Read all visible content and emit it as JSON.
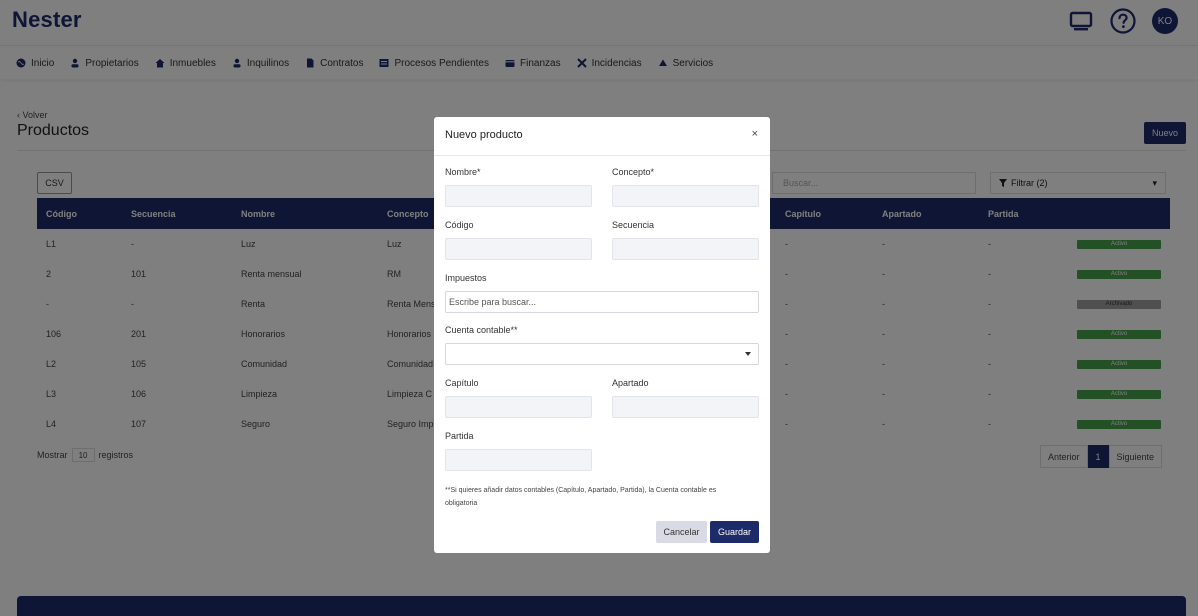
{
  "app": {
    "brand": "Nester",
    "avatar_initials": "KO"
  },
  "colors": {
    "primary": "#1e2b6b",
    "active_badge": "#46a049",
    "archived_badge": "#9e9e9e"
  },
  "nav": [
    {
      "label": "Inicio",
      "icon": "globe-icon"
    },
    {
      "label": "Propietarios",
      "icon": "user-icon"
    },
    {
      "label": "Inmuebles",
      "icon": "home-icon"
    },
    {
      "label": "Inquilinos",
      "icon": "user-icon"
    },
    {
      "label": "Contratos",
      "icon": "document-icon"
    },
    {
      "label": "Procesos Pendientes",
      "icon": "list-icon"
    },
    {
      "label": "Finanzas",
      "icon": "wallet-icon"
    },
    {
      "label": "Incidencias",
      "icon": "tools-icon"
    },
    {
      "label": "Servicios",
      "icon": "triangle-icon"
    }
  ],
  "page": {
    "back_label": "Volver",
    "title": "Productos",
    "new_label": "Nuevo"
  },
  "toolbar": {
    "csv_label": "CSV",
    "search_placeholder": "Buscar...",
    "filter_label": "Filtrar (2)"
  },
  "table": {
    "columns": [
      "Código",
      "Secuencia",
      "Nombre",
      "Concepto",
      "Capítulo",
      "Apartado",
      "Partida"
    ],
    "rows": [
      {
        "codigo": "L1",
        "secuencia": "-",
        "nombre": "Luz",
        "concepto": "Luz",
        "capitulo": "-",
        "apartado": "-",
        "partida": "-",
        "estado": "Activo"
      },
      {
        "codigo": "2",
        "secuencia": "101",
        "nombre": "Renta mensual",
        "concepto": "RM",
        "capitulo": "-",
        "apartado": "-",
        "partida": "-",
        "estado": "Activo"
      },
      {
        "codigo": "-",
        "secuencia": "-",
        "nombre": "Renta",
        "concepto": "Renta Mens",
        "capitulo": "-",
        "apartado": "-",
        "partida": "-",
        "estado": "Archivado"
      },
      {
        "codigo": "106",
        "secuencia": "201",
        "nombre": "Honorarios",
        "concepto": "Honorarios",
        "capitulo": "-",
        "apartado": "-",
        "partida": "-",
        "estado": "Activo"
      },
      {
        "codigo": "L2",
        "secuencia": "105",
        "nombre": "Comunidad",
        "concepto": "Comunidad",
        "capitulo": "-",
        "apartado": "-",
        "partida": "-",
        "estado": "Activo"
      },
      {
        "codigo": "L3",
        "secuencia": "106",
        "nombre": "Limpieza",
        "concepto": "Limpieza C",
        "capitulo": "-",
        "apartado": "-",
        "partida": "-",
        "estado": "Activo"
      },
      {
        "codigo": "L4",
        "secuencia": "107",
        "nombre": "Seguro",
        "concepto": "Seguro Imp",
        "capitulo": "-",
        "apartado": "-",
        "partida": "-",
        "estado": "Activo"
      }
    ]
  },
  "pagination": {
    "show_label": "Mostrar",
    "per_page": "10",
    "records_label": "registros",
    "prev": "Anterior",
    "current": "1",
    "next": "Siguiente"
  },
  "modal": {
    "title": "Nuevo producto",
    "close": "×",
    "labels": {
      "nombre": "Nombre*",
      "concepto": "Concepto*",
      "codigo": "Código",
      "secuencia": "Secuencia",
      "impuestos": "Impuestos",
      "cuenta": "Cuenta contable**",
      "capitulo": "Capítulo",
      "apartado": "Apartado",
      "partida": "Partida"
    },
    "impuestos_placeholder": "Escribe para buscar...",
    "note": "**Si quieres añadir datos contables (Capítulo, Apartado, Partida), la Cuenta contable es obligatoria",
    "cancel": "Cancelar",
    "save": "Guardar"
  }
}
